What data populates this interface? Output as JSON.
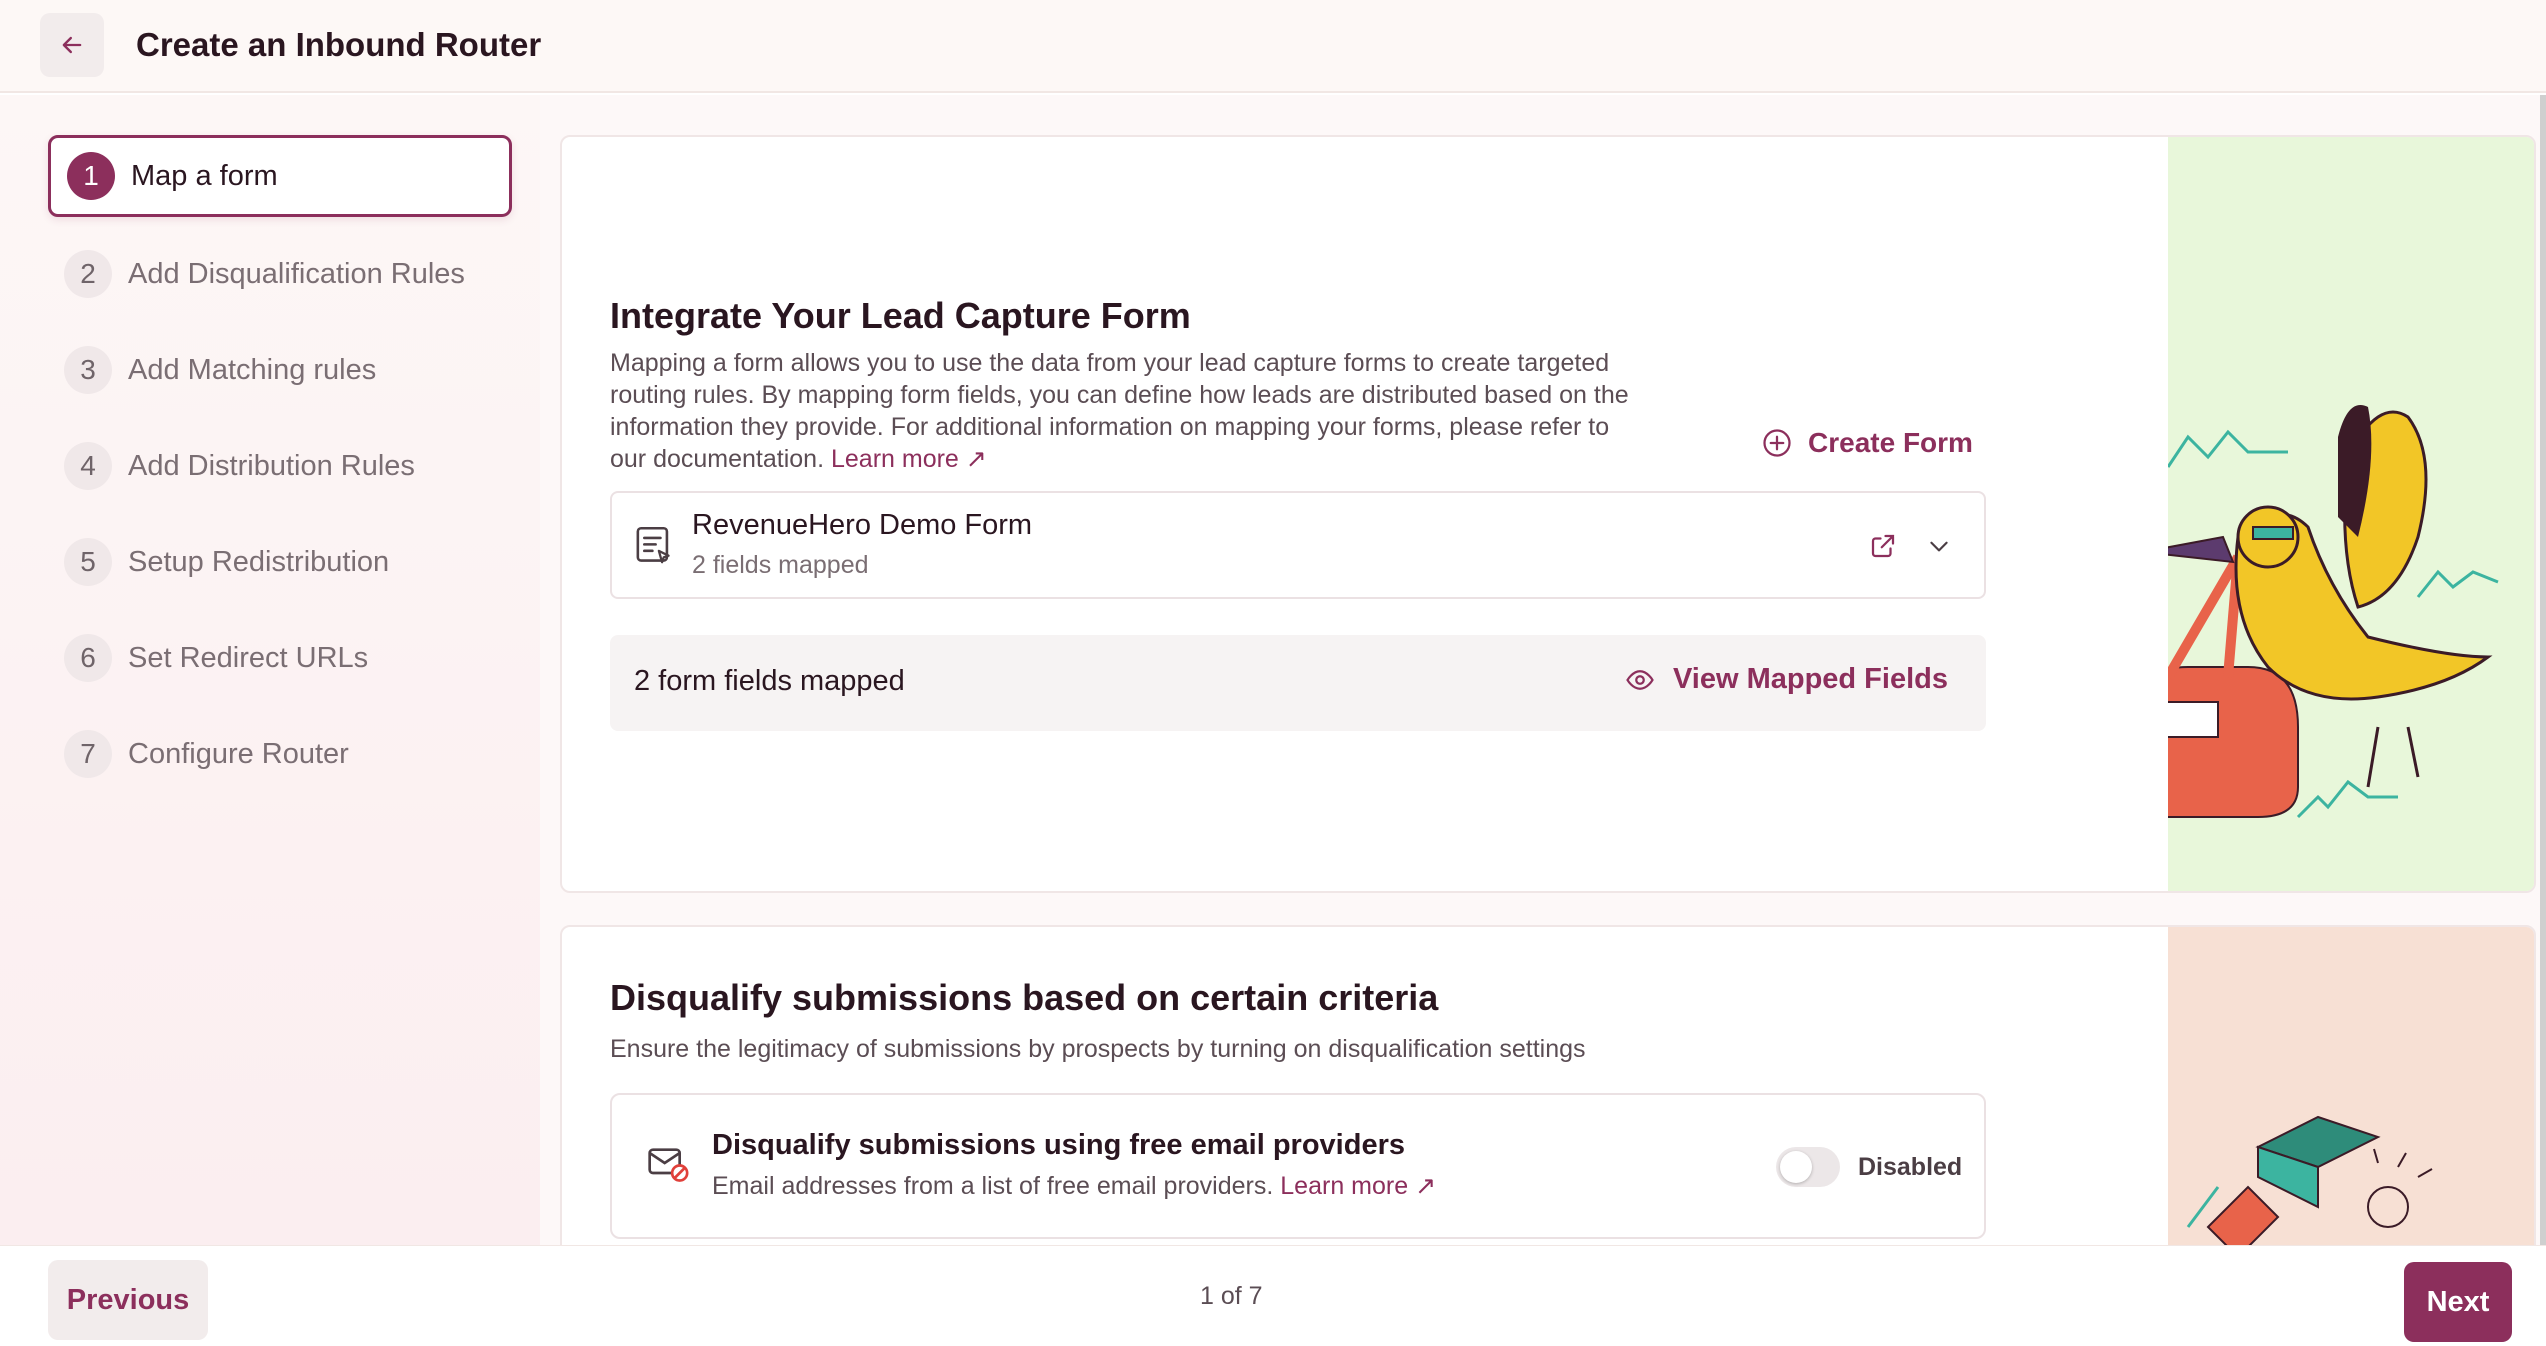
{
  "header": {
    "title": "Create an Inbound Router"
  },
  "sidebar": {
    "steps": [
      {
        "num": "1",
        "label": "Map a form"
      },
      {
        "num": "2",
        "label": "Add Disqualification Rules"
      },
      {
        "num": "3",
        "label": "Add Matching rules"
      },
      {
        "num": "4",
        "label": "Add Distribution Rules"
      },
      {
        "num": "5",
        "label": "Setup Redistribution"
      },
      {
        "num": "6",
        "label": "Set Redirect URLs"
      },
      {
        "num": "7",
        "label": "Configure Router"
      }
    ]
  },
  "integrate": {
    "title": "Integrate Your Lead Capture Form",
    "description": "Mapping a form allows you to use the data from your lead capture forms to create targeted routing rules. By mapping form fields, you can define how leads are distributed based on the information they provide. For additional information on mapping your forms, please refer to our documentation.",
    "learn_more": "Learn more ↗",
    "create_form": "Create Form",
    "form_name": "RevenueHero Demo Form",
    "form_sub": "2 fields mapped",
    "mapped_text": "2 form fields mapped",
    "view_mapped": "View Mapped Fields"
  },
  "disqualify": {
    "title": "Disqualify submissions based on certain criteria",
    "description": "Ensure the legitimacy of submissions by prospects by turning on disqualification settings",
    "rule_title": "Disqualify submissions using free email providers",
    "rule_sub": "Email addresses from a list of free email providers.",
    "learn_more": "Learn more ↗",
    "toggle_label": "Disabled"
  },
  "footer": {
    "previous": "Previous",
    "page_indicator": "1 of 7",
    "next": "Next"
  },
  "colors": {
    "accent": "#8c2f5c",
    "illustration_bg_1": "#e8f7da",
    "illustration_bg_2": "#f7e0d4"
  }
}
